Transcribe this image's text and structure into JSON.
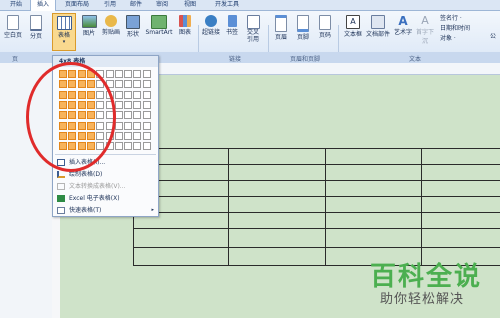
{
  "tabs": [
    "开始",
    "插入",
    "页面布局",
    "引用",
    "邮件",
    "审阅",
    "视图",
    "开发工具"
  ],
  "active_tab": "插入",
  "ribbon": {
    "buttons": [
      {
        "label": "空白页",
        "icon": "blank-page-icon"
      },
      {
        "label": "分页",
        "icon": "page-break-icon"
      },
      {
        "label": "表格",
        "icon": "table-icon"
      },
      {
        "label": "图片",
        "icon": "picture-icon"
      },
      {
        "label": "剪贴画",
        "icon": "clipart-icon"
      },
      {
        "label": "形状",
        "icon": "shapes-icon"
      },
      {
        "label": "SmartArt",
        "icon": "smartart-icon"
      },
      {
        "label": "图表",
        "icon": "chart-icon"
      },
      {
        "label": "超链接",
        "icon": "hyperlink-icon"
      },
      {
        "label": "书签",
        "icon": "bookmark-icon"
      },
      {
        "label": "交叉引用",
        "icon": "cross-reference-icon"
      },
      {
        "label": "页眉",
        "icon": "header-icon"
      },
      {
        "label": "页脚",
        "icon": "footer-icon"
      },
      {
        "label": "页码",
        "icon": "page-number-icon"
      },
      {
        "label": "文本框",
        "icon": "textbox-icon"
      },
      {
        "label": "文档部件",
        "icon": "quick-parts-icon"
      },
      {
        "label": "艺术字",
        "icon": "wordart-icon"
      },
      {
        "label": "首字下沉",
        "icon": "dropcap-icon"
      }
    ],
    "side_items": [
      "签名行 ·",
      "日期和时间",
      "对象 ·"
    ],
    "groups": [
      "页",
      "链接",
      "页眉和页脚",
      "文本"
    ],
    "right_cut": "公"
  },
  "dropdown": {
    "title": "4x8 表格",
    "grid": {
      "cols": 10,
      "rows": 8,
      "selected_cols": 4,
      "selected_rows": 8
    },
    "items": [
      {
        "label": "插入表格(I)...",
        "enabled": true,
        "icon": "insert-table-icon"
      },
      {
        "label": "绘制表格(D)",
        "enabled": true,
        "icon": "draw-table-icon"
      },
      {
        "label": "文本转换成表格(V)...",
        "enabled": false,
        "icon": "convert-text-icon"
      },
      {
        "label": "Excel 电子表格(X)",
        "enabled": true,
        "icon": "excel-icon"
      },
      {
        "label": "快速表格(T)",
        "enabled": true,
        "icon": "quick-table-icon"
      }
    ]
  },
  "watermark": {
    "line1": "百科全说",
    "line2": "助你轻松解决"
  },
  "colors": {
    "accent": "#f7b35b",
    "highlight_ring": "#e02b2b",
    "doc_bg": "#cfe3c9"
  }
}
